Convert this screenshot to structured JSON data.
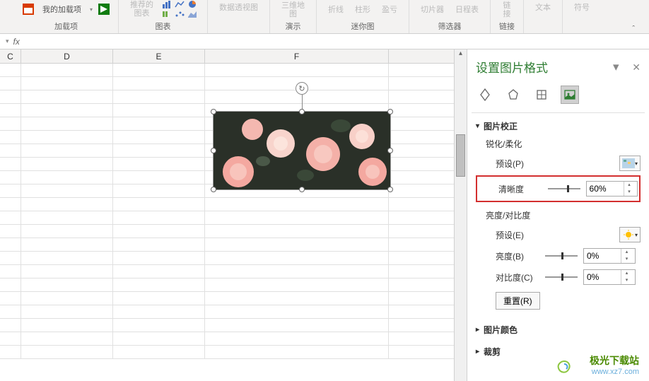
{
  "ribbon": {
    "addins": {
      "my_addins": "我的加载项",
      "group_label": "加载项"
    },
    "charts": {
      "recommended": "推荐的\n图表",
      "group_label": "图表"
    },
    "pivot": "数据透视图",
    "map3d": {
      "label": "三维地\n图",
      "group_label": "演示"
    },
    "sparklines": {
      "line": "折线",
      "column": "柱形",
      "winloss": "盈亏",
      "group_label": "迷你图"
    },
    "filters": {
      "slicer": "切片器",
      "timeline": "日程表",
      "group_label": "筛选器"
    },
    "links": {
      "link": "链\n接",
      "group_label": "链接"
    },
    "text": {
      "label": "文本"
    },
    "symbols": {
      "label": "符号"
    }
  },
  "formula_bar": {
    "fx": "fx"
  },
  "columns": [
    "C",
    "D",
    "E",
    "F"
  ],
  "panel": {
    "title": "设置图片格式",
    "sections": {
      "corrections": {
        "title": "图片校正",
        "sharpen_soften": "锐化/柔化",
        "preset_p": "预设(P)",
        "sharpness": {
          "label": "清晰度",
          "value": "60%"
        },
        "brightness_contrast": "亮度/对比度",
        "preset_e": "预设(E)",
        "brightness": {
          "label": "亮度(B)",
          "value": "0%"
        },
        "contrast": {
          "label": "对比度(C)",
          "value": "0%"
        },
        "reset": "重置(R)"
      },
      "color": "图片颜色",
      "crop": "裁剪"
    }
  },
  "watermark": {
    "title": "极光下载站",
    "url": "www.xz7.com"
  }
}
